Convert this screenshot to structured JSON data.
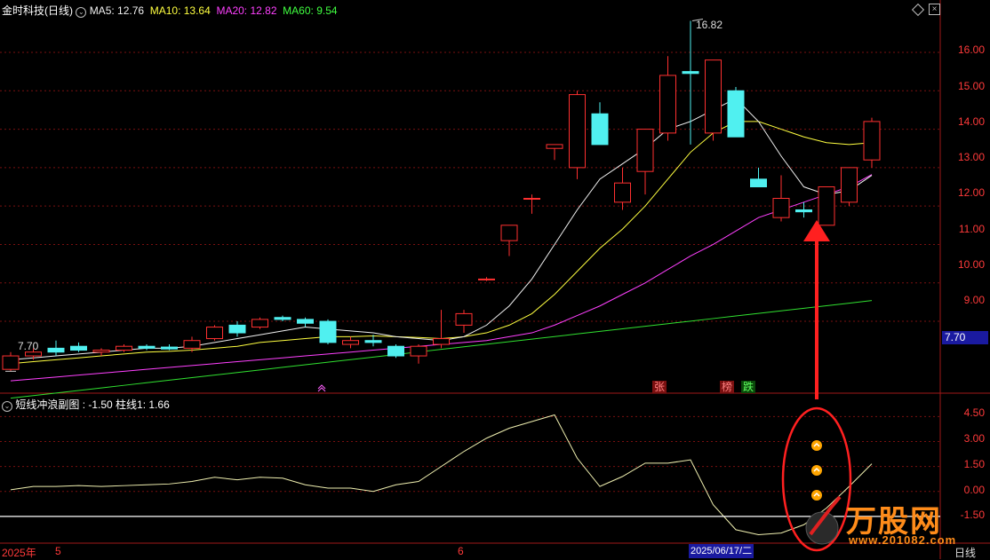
{
  "header": {
    "title": "金时科技(日线)",
    "ma5": "MA5: 12.76",
    "ma10": "MA10: 13.64",
    "ma20": "MA20: 12.82",
    "ma60": "MA60: 9.54"
  },
  "price_axis": {
    "ticks": [
      "16.00",
      "15.00",
      "14.00",
      "13.00",
      "12.00",
      "11.00",
      "10.00",
      "9.00"
    ]
  },
  "current_price_flag": "7.70",
  "annotations": {
    "high_label": "16.82",
    "low_label": "7.70",
    "badge_zhang": "张",
    "badge_bang": "榜",
    "badge_die": "跌"
  },
  "sub_panel": {
    "title": "短线冲浪副图",
    "values": ": -1.50  柱线1: 1.66",
    "ticks": [
      "4.50",
      "3.00",
      "1.50",
      "0.00",
      "-1.50"
    ]
  },
  "bottom_axis": {
    "year": "2025年",
    "m5": "5",
    "m6": "6",
    "date": "2025/06/17/二",
    "period": "日线"
  },
  "watermark": {
    "name": "万股网",
    "site": "www.201082.com"
  },
  "colors": {
    "up": "#ff3030",
    "down": "#50f0f0",
    "ma5": "#f0f0f0",
    "ma10": "#ffff40",
    "ma20": "#ff40ff",
    "ma60": "#30e030",
    "arrow": "#ff2020"
  },
  "chart_data": {
    "type": "candlestick",
    "ylim": [
      7.2,
      16.9
    ],
    "candles": [
      {
        "o": 7.75,
        "h": 8.2,
        "l": 7.7,
        "c": 8.1
      },
      {
        "o": 8.1,
        "h": 8.3,
        "l": 8.0,
        "c": 8.2
      },
      {
        "o": 8.3,
        "h": 8.5,
        "l": 8.1,
        "c": 8.2
      },
      {
        "o": 8.35,
        "h": 8.45,
        "l": 8.2,
        "c": 8.25
      },
      {
        "o": 8.2,
        "h": 8.3,
        "l": 8.1,
        "c": 8.25
      },
      {
        "o": 8.25,
        "h": 8.4,
        "l": 8.2,
        "c": 8.35
      },
      {
        "o": 8.35,
        "h": 8.4,
        "l": 8.25,
        "c": 8.3
      },
      {
        "o": 8.33,
        "h": 8.4,
        "l": 8.25,
        "c": 8.28
      },
      {
        "o": 8.3,
        "h": 8.6,
        "l": 8.2,
        "c": 8.5
      },
      {
        "o": 8.55,
        "h": 8.9,
        "l": 8.5,
        "c": 8.85
      },
      {
        "o": 8.9,
        "h": 9.0,
        "l": 8.6,
        "c": 8.7
      },
      {
        "o": 8.85,
        "h": 9.1,
        "l": 8.8,
        "c": 9.05
      },
      {
        "o": 9.1,
        "h": 9.15,
        "l": 9.0,
        "c": 9.05
      },
      {
        "o": 9.05,
        "h": 9.1,
        "l": 8.85,
        "c": 8.95
      },
      {
        "o": 9.0,
        "h": 9.05,
        "l": 8.4,
        "c": 8.45
      },
      {
        "o": 8.4,
        "h": 8.6,
        "l": 8.3,
        "c": 8.5
      },
      {
        "o": 8.5,
        "h": 8.65,
        "l": 8.35,
        "c": 8.45
      },
      {
        "o": 8.35,
        "h": 8.4,
        "l": 8.05,
        "c": 8.1
      },
      {
        "o": 8.1,
        "h": 8.4,
        "l": 7.9,
        "c": 8.35
      },
      {
        "o": 8.4,
        "h": 9.3,
        "l": 8.3,
        "c": 8.55
      },
      {
        "o": 8.9,
        "h": 9.3,
        "l": 8.7,
        "c": 9.2
      },
      {
        "o": 10.1,
        "h": 10.15,
        "l": 10.05,
        "c": 10.1
      },
      {
        "o": 11.1,
        "h": 11.5,
        "l": 10.7,
        "c": 11.5
      },
      {
        "o": 12.2,
        "h": 12.3,
        "l": 11.8,
        "c": 12.2
      },
      {
        "o": 13.5,
        "h": 13.6,
        "l": 13.2,
        "c": 13.6
      },
      {
        "o": 13.0,
        "h": 15.0,
        "l": 12.7,
        "c": 14.9
      },
      {
        "o": 14.4,
        "h": 14.7,
        "l": 13.6,
        "c": 13.6
      },
      {
        "o": 12.1,
        "h": 13.0,
        "l": 11.9,
        "c": 12.6
      },
      {
        "o": 12.9,
        "h": 14.0,
        "l": 12.3,
        "c": 14.0
      },
      {
        "o": 13.9,
        "h": 15.9,
        "l": 13.7,
        "c": 15.4
      },
      {
        "o": 15.5,
        "h": 16.82,
        "l": 13.6,
        "c": 15.45
      },
      {
        "o": 13.9,
        "h": 15.8,
        "l": 13.7,
        "c": 15.8
      },
      {
        "o": 15.0,
        "h": 15.1,
        "l": 13.8,
        "c": 13.8
      },
      {
        "o": 12.7,
        "h": 13.0,
        "l": 12.5,
        "c": 12.5
      },
      {
        "o": 11.7,
        "h": 12.8,
        "l": 11.6,
        "c": 12.2
      },
      {
        "o": 11.9,
        "h": 12.1,
        "l": 11.7,
        "c": 11.85
      },
      {
        "o": 11.5,
        "h": 12.5,
        "l": 11.5,
        "c": 12.5
      },
      {
        "o": 12.1,
        "h": 13.0,
        "l": 12.0,
        "c": 13.0
      },
      {
        "o": 13.2,
        "h": 14.3,
        "l": 13.0,
        "c": 14.2
      }
    ],
    "ma5": [
      8.0,
      8.05,
      8.1,
      8.15,
      8.2,
      8.25,
      8.3,
      8.3,
      8.35,
      8.45,
      8.55,
      8.65,
      8.75,
      8.85,
      8.8,
      8.75,
      8.7,
      8.6,
      8.55,
      8.5,
      8.6,
      8.9,
      9.4,
      10.1,
      11.0,
      11.9,
      12.7,
      13.1,
      13.5,
      14.0,
      14.2,
      14.5,
      14.8,
      14.2,
      13.3,
      12.5,
      12.3,
      12.4,
      12.8
    ],
    "ma10": [
      7.9,
      7.95,
      8.0,
      8.05,
      8.1,
      8.15,
      8.2,
      8.22,
      8.25,
      8.3,
      8.35,
      8.45,
      8.5,
      8.55,
      8.6,
      8.6,
      8.62,
      8.6,
      8.58,
      8.55,
      8.6,
      8.7,
      8.9,
      9.2,
      9.7,
      10.3,
      10.9,
      11.4,
      12.0,
      12.7,
      13.4,
      13.9,
      14.2,
      14.2,
      14.0,
      13.8,
      13.65,
      13.6,
      13.65
    ],
    "ma20": [
      7.45,
      7.5,
      7.55,
      7.6,
      7.65,
      7.7,
      7.75,
      7.8,
      7.85,
      7.9,
      7.95,
      8.0,
      8.05,
      8.1,
      8.15,
      8.2,
      8.25,
      8.3,
      8.35,
      8.4,
      8.45,
      8.5,
      8.6,
      8.7,
      8.9,
      9.15,
      9.4,
      9.7,
      10.0,
      10.35,
      10.7,
      11.0,
      11.35,
      11.7,
      11.9,
      12.1,
      12.3,
      12.5,
      12.82
    ],
    "ma60_start": 7.0,
    "ma60_end": 9.54,
    "osc": [
      0.1,
      0.3,
      0.3,
      0.35,
      0.3,
      0.35,
      0.4,
      0.45,
      0.6,
      0.85,
      0.7,
      0.85,
      0.8,
      0.4,
      0.2,
      0.2,
      0.0,
      0.4,
      0.6,
      1.5,
      2.4,
      3.2,
      3.8,
      4.2,
      4.6,
      2.0,
      0.3,
      0.9,
      1.7,
      1.7,
      1.9,
      -0.8,
      -2.3,
      -2.6,
      -2.5,
      -2.0,
      -1.0,
      0.3,
      1.66
    ],
    "osc_ylim": [
      -3.0,
      5.0
    ],
    "osc_ref": -1.5
  }
}
